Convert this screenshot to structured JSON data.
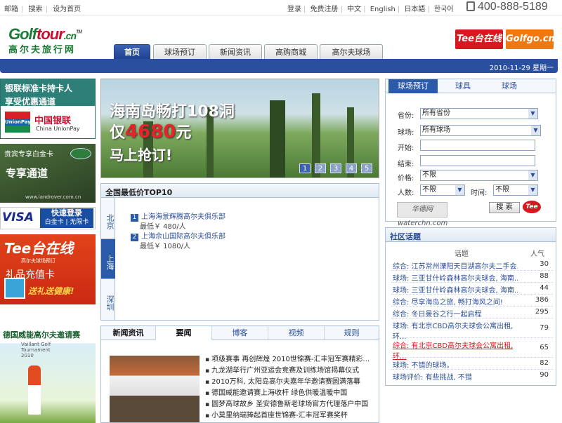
{
  "topbar": {
    "left_links": [
      "邮箱",
      "搜索",
      "设为首页"
    ],
    "right_links": [
      "登录",
      "免费注册",
      "中文",
      "English",
      "日本語",
      "한국어"
    ],
    "phone": "400-888-5189"
  },
  "logo": {
    "en_part1": "Golf",
    "en_part2": "tour",
    "en_suffix": ".cn",
    "tm": "TM",
    "cn": "高尔夫旅行网"
  },
  "nav": {
    "tabs": [
      "首页",
      "球场预订",
      "新闻资讯",
      "高购商城",
      "高尔夫球场"
    ],
    "active": "首页"
  },
  "badges": {
    "tee": "Tee台在线",
    "golfgo": "Golfgo.cn"
  },
  "date": "2010-11-29 星期一",
  "left_banners": {
    "unionpay": {
      "line1": "银联标准卡持卡人",
      "line2": "享受优惠通道",
      "logo": "UnionPay 银联",
      "name_cn": "中国银联",
      "name_en": "China UnionPay"
    },
    "landrover": {
      "line1": "贵宾专享白金卡",
      "line2": "专享通道",
      "url": "www.landrover.com.cn"
    },
    "visa": {
      "brand": "VISA",
      "line1": "快速登录",
      "line2": "白金卡 | 无限卡"
    },
    "tee": {
      "brand": "Tee台在线",
      "sub": "高尔夫球场预订",
      "line": "礼品充值卡",
      "slogan": "送礼送健康!"
    },
    "vaillant": {
      "title": "德国威能高尔夫邀请赛",
      "sub": "Vaillant Golf Tournament",
      "year": "2010"
    }
  },
  "hero": {
    "line1": "海南岛畅打108洞",
    "line2_prefix": "仅",
    "price": "4680",
    "line2_suffix": "元",
    "line3": "马上抢订!",
    "dots": [
      "1",
      "2",
      "3",
      "4",
      "5"
    ],
    "active_dot": "1"
  },
  "top10": {
    "title": "全国最低价TOP10",
    "regions": [
      "北京",
      "上海",
      "深圳"
    ],
    "active_region": "上海",
    "items": [
      {
        "rank": "1",
        "name": "上海海景辉腾高尔夫俱乐部",
        "price": "最低￥ 480/人"
      },
      {
        "rank": "2",
        "name": "上海佘山国际高尔夫俱乐部",
        "price": "最低￥ 1080/人"
      }
    ]
  },
  "news": {
    "tabs": [
      "新闻资讯",
      "要闻",
      "博客",
      "视频",
      "规则"
    ],
    "active_tab": "要闻",
    "items": [
      "项级赛事 再创辉煌 2010世锦赛-汇丰冠军赛精彩...",
      "九龙湖举行广州亚运会竞赛及训练场馆揭幕仪式",
      "2010万科, 太阳岛高尔夫嘉年华邀请赛圆满落幕",
      "德国威能邀请赛上海收杆 绿色供暖温暖中国",
      "圆梦高球故乡 圣安德鲁斯老球场官方代理落户中国",
      "小莫里纳瑞捧起首座世锦赛-汇丰冠军赛奖杯"
    ]
  },
  "search": {
    "tabs": [
      "球场预订",
      "球具",
      "球场"
    ],
    "active_tab": "球场预订",
    "province_label": "省份:",
    "province_value": "所有省份",
    "course_label": "球场:",
    "course_value": "所有球场",
    "start_label": "开始:",
    "end_label": "结束:",
    "price_label": "价格:",
    "price_value": "不限",
    "people_label": "人数:",
    "people_value": "不限",
    "time_label": "时间:",
    "time_value": "不限",
    "partner": "华德网 waterchn.com",
    "button": "搜 索",
    "tee": "Tee"
  },
  "community": {
    "title": "社区话题",
    "col_topic": "话题",
    "col_pop": "人气",
    "rows": [
      {
        "topic": "综合: 江苏常州溧阳天目湖高尔夫二手会...",
        "pop": "30"
      },
      {
        "topic": "球场: 三亚甘什岭森林高尔夫球会, 海南...",
        "pop": "88"
      },
      {
        "topic": "球场: 三亚甘什岭森林高尔夫球会, 海南...",
        "pop": "44"
      },
      {
        "topic": "综合: 尽享海岛之旅, 畅打海风之间!",
        "pop": "386"
      },
      {
        "topic": "综合: 冬日曼谷之行一起启程",
        "pop": "295"
      },
      {
        "topic": "球场: 有北京CBD高尔夫球会公寓出租, 环...",
        "pop": "79"
      },
      {
        "topic": "综合: 有北京CBD高尔夫球会公寓出租, 环...",
        "pop": "65"
      },
      {
        "topic": "球场: 不错的球场。",
        "pop": "82"
      },
      {
        "topic": "球场评价: 有些挑战, 不错",
        "pop": "90"
      }
    ],
    "highlight_row": 6
  }
}
